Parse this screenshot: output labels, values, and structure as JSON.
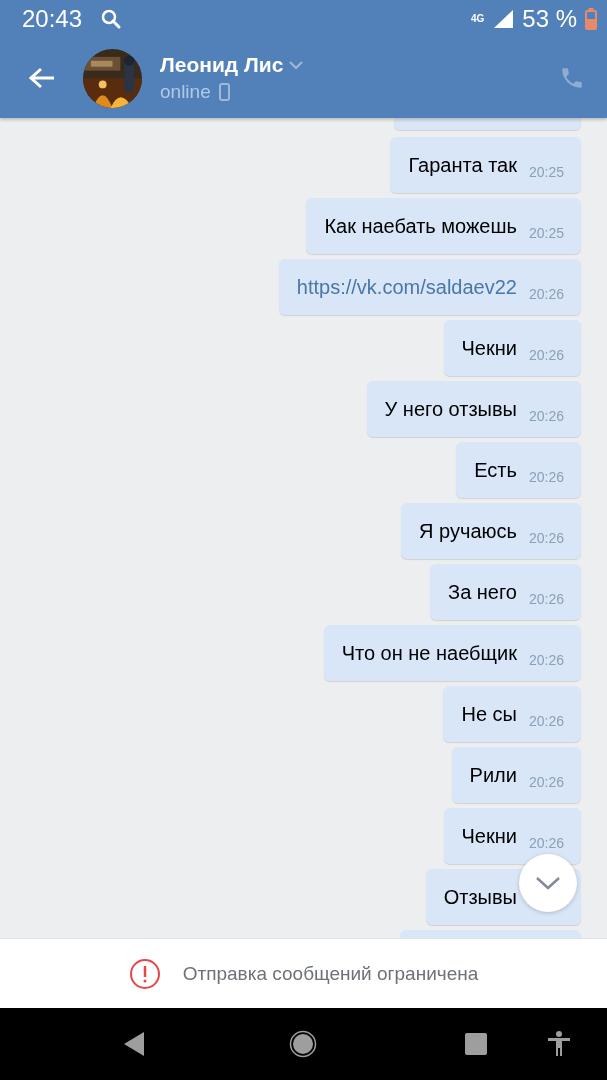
{
  "status_bar": {
    "time": "20:43",
    "network": "4G",
    "battery": "53 %"
  },
  "header": {
    "name": "Леонид Лис",
    "status": "online"
  },
  "messages": [
    {
      "kind": "text",
      "text": "Гаранта так",
      "time": "20:25"
    },
    {
      "kind": "text",
      "text": "Как наебать можешь",
      "time": "20:25"
    },
    {
      "kind": "link",
      "text": "https://vk.com/saldaev22",
      "time": "20:26"
    },
    {
      "kind": "text",
      "text": "Чекни",
      "time": "20:26"
    },
    {
      "kind": "text",
      "text": "У него отзывы",
      "time": "20:26"
    },
    {
      "kind": "text",
      "text": "Есть",
      "time": "20:26"
    },
    {
      "kind": "text",
      "text": "Я ручаюсь",
      "time": "20:26"
    },
    {
      "kind": "text",
      "text": "За него",
      "time": "20:26"
    },
    {
      "kind": "text",
      "text": "Что он не наебщик",
      "time": "20:26"
    },
    {
      "kind": "text",
      "text": "Не сы",
      "time": "20:26"
    },
    {
      "kind": "text",
      "text": "Рили",
      "time": "20:26"
    },
    {
      "kind": "text",
      "text": "Чекни",
      "time": "20:26"
    },
    {
      "kind": "text",
      "text": "Отзывы"
    }
  ],
  "notice": {
    "text": "Отправка сообщений ограничена"
  }
}
